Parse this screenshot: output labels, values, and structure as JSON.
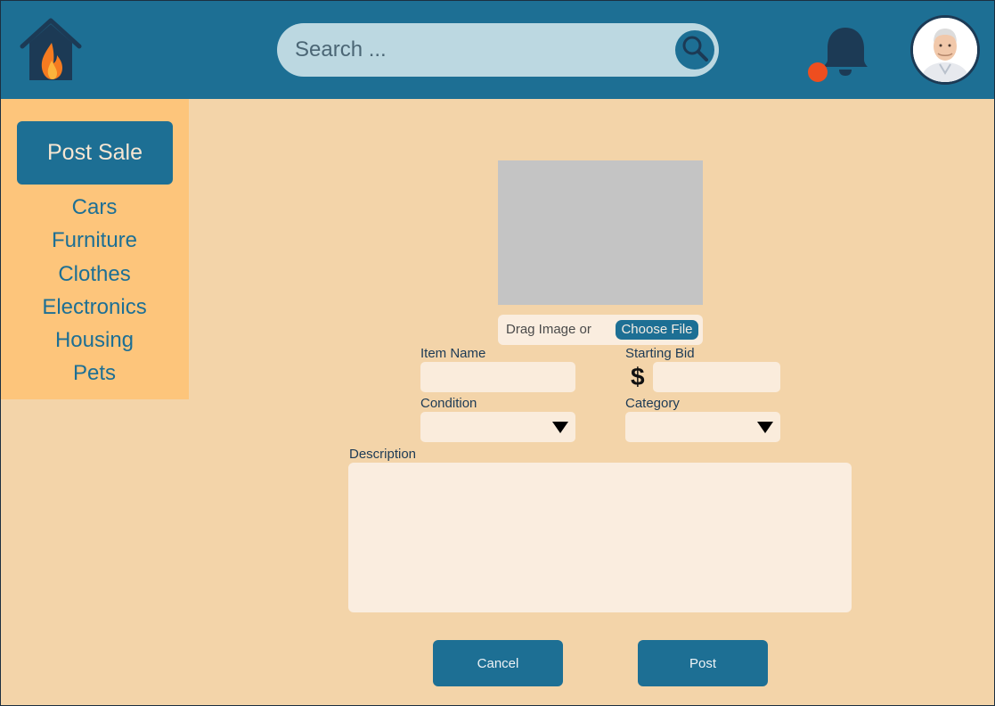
{
  "colors": {
    "header_bg": "#1d6f94",
    "page_bg": "#f3d4a9",
    "sidebar_bg": "#fdc57b",
    "accent": "#1d6f94",
    "notification_dot": "#ee4e1f"
  },
  "header": {
    "logo_icon": "house-fire-icon",
    "search": {
      "placeholder": "Search ...",
      "icon": "search-icon"
    },
    "notification_icon": "bell-icon",
    "avatar_icon": "user-avatar"
  },
  "sidebar": {
    "post_sale_label": "Post Sale",
    "categories": [
      "Cars",
      "Furniture",
      "Clothes",
      "Electronics",
      "Housing",
      "Pets"
    ]
  },
  "form": {
    "drop_text": "Drag Image or",
    "choose_file_label": "Choose File",
    "item_name_label": "Item Name",
    "item_name_value": "",
    "starting_bid_label": "Starting Bid",
    "currency_symbol": "$",
    "starting_bid_value": "",
    "condition_label": "Condition",
    "condition_value": "",
    "category_label": "Category",
    "category_value": "",
    "description_label": "Description",
    "description_value": "",
    "cancel_label": "Cancel",
    "post_label": "Post"
  }
}
